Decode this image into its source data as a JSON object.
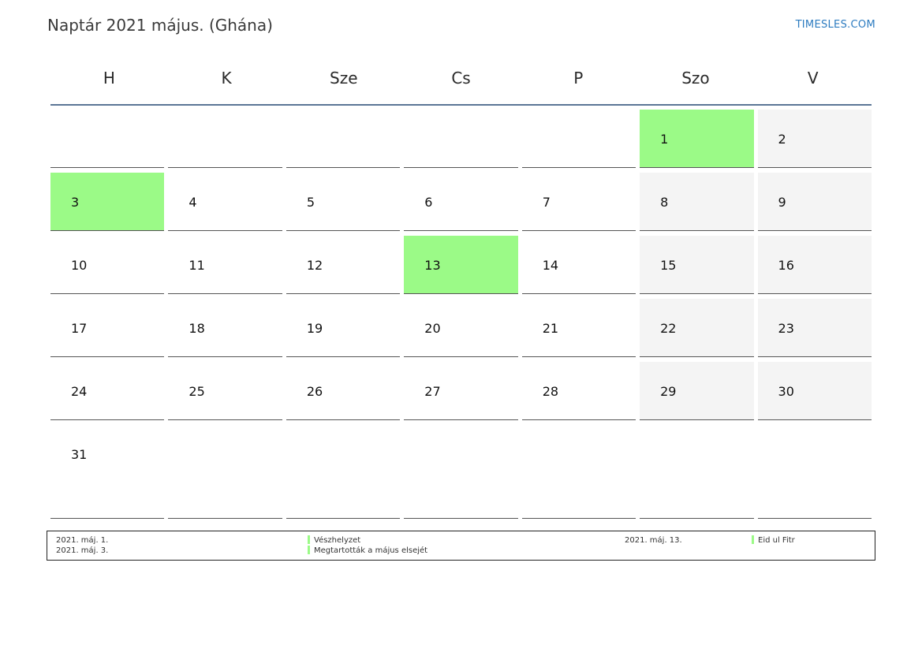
{
  "header": {
    "title": "Naptár 2021 május. (Ghána)",
    "brand": "TIMESLES.COM"
  },
  "weekdays": [
    "H",
    "K",
    "Sze",
    "Cs",
    "P",
    "Szo",
    "V"
  ],
  "weeks": [
    [
      "",
      "",
      "",
      "",
      "",
      "1",
      "2"
    ],
    [
      "3",
      "4",
      "5",
      "6",
      "7",
      "8",
      "9"
    ],
    [
      "10",
      "11",
      "12",
      "13",
      "14",
      "15",
      "16"
    ],
    [
      "17",
      "18",
      "19",
      "20",
      "21",
      "22",
      "23"
    ],
    [
      "24",
      "25",
      "26",
      "27",
      "28",
      "29",
      "30"
    ],
    [
      "31",
      "",
      "",
      "",
      "",
      "",
      ""
    ]
  ],
  "holidays": [
    "1",
    "3",
    "13"
  ],
  "colors": {
    "holiday": "#9bfa87",
    "weekend": "#f4f4f4",
    "header_rule": "#5b7696",
    "brand": "#2c7bc0"
  },
  "legend": {
    "left": [
      {
        "date": "2021. máj. 1.",
        "name": "Vészhelyzet"
      },
      {
        "date": "2021. máj. 3.",
        "name": "Megtartották a május elsejét"
      }
    ],
    "right": [
      {
        "date": "2021. máj. 13.",
        "name": "Eid ul Fitr"
      }
    ]
  }
}
